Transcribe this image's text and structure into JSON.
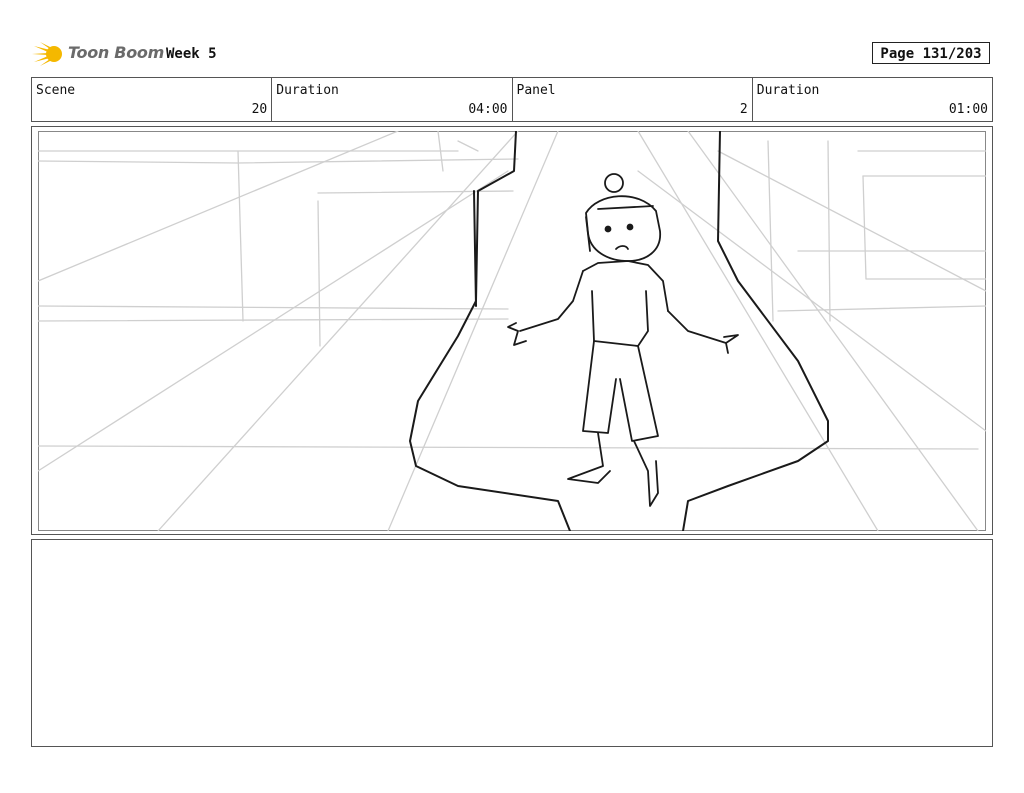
{
  "header": {
    "brand": "Toon Boom",
    "project": "Week 5",
    "page": "Page 131/203"
  },
  "info": {
    "scene_label": "Scene",
    "scene_value": "20",
    "duration_label": "Duration",
    "duration_value": "04:00",
    "panel_label": "Panel",
    "panel_value": "2",
    "panel_duration_label": "Duration",
    "panel_duration_value": "01:00"
  },
  "colors": {
    "logo_accent": "#f5b800",
    "sketch_light": "#c8c8c8",
    "sketch_dark": "#1a1a1a"
  },
  "notes": ""
}
